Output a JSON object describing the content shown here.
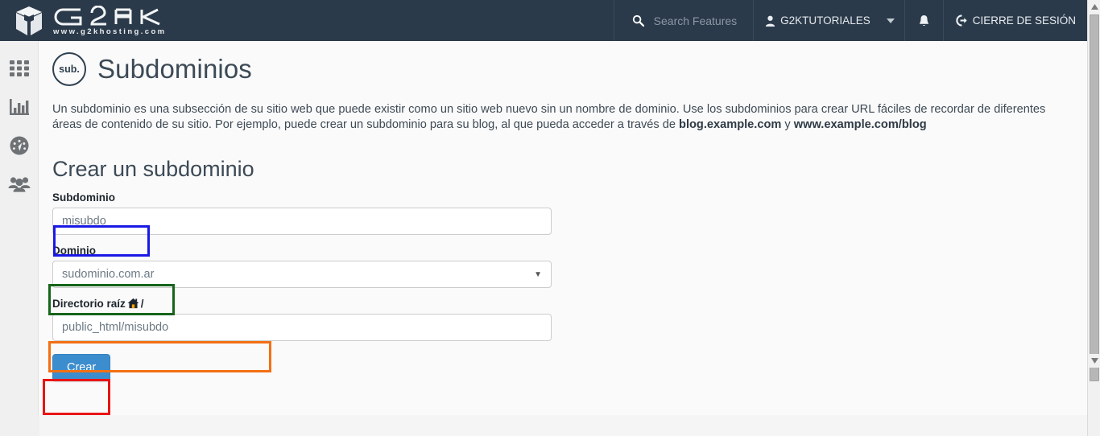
{
  "header": {
    "logo_brand": "G2K",
    "logo_url": "www.g2khosting.com",
    "search_placeholder": "Search Features",
    "search_icon": "search-icon",
    "user_label": "G2KTUTORIALES",
    "user_icon": "user-icon",
    "caret_icon": "chevron-down-icon",
    "bell_icon": "bell-icon",
    "logout_label": "CIERRE DE SESIÓN",
    "logout_icon": "logout-icon",
    "bg_color": "#2b3a4a"
  },
  "sidebar": {
    "items": [
      {
        "name": "sidebar-item-apps",
        "icon": "grid-icon"
      },
      {
        "name": "sidebar-item-statistics",
        "icon": "bar-chart-icon"
      },
      {
        "name": "sidebar-item-metrics",
        "icon": "gauge-icon"
      },
      {
        "name": "sidebar-item-users",
        "icon": "users-icon"
      }
    ]
  },
  "main": {
    "badge_text": "sub.",
    "page_title": "Subdominios",
    "description": {
      "part1": "Un subdominio es una subsección de su sitio web que puede existir como un sitio web nuevo sin un nombre de dominio. Use los subdominios para crear URL fáciles de recordar de diferentes áreas de contenido de su sitio. Por ejemplo, puede crear un subdominio para su blog, al que pueda acceder a través de ",
      "bold1": "blog.example.com",
      "part2": " y ",
      "bold2": "www.example.com/blog"
    },
    "section_title": "Crear un subdominio",
    "fields": {
      "subdomain": {
        "label": "Subdominio",
        "value": "misubdo"
      },
      "domain": {
        "label": "Dominio",
        "value": "sudominio.com.ar",
        "caret": "▼"
      },
      "docroot": {
        "label_prefix": "Directorio raíz ",
        "label_suffix": "/",
        "home_icon": "home-icon",
        "value": "public_html/misubdo"
      }
    },
    "create_button": "Crear"
  },
  "annotations": {
    "subdomain_box_color": "#1919e6",
    "domain_box_color": "#16651a",
    "docroot_box_color": "#f36f13",
    "button_box_color": "#e81414"
  },
  "scrollbar": {
    "up_arrow": "▲",
    "down_arrow": "▼"
  }
}
